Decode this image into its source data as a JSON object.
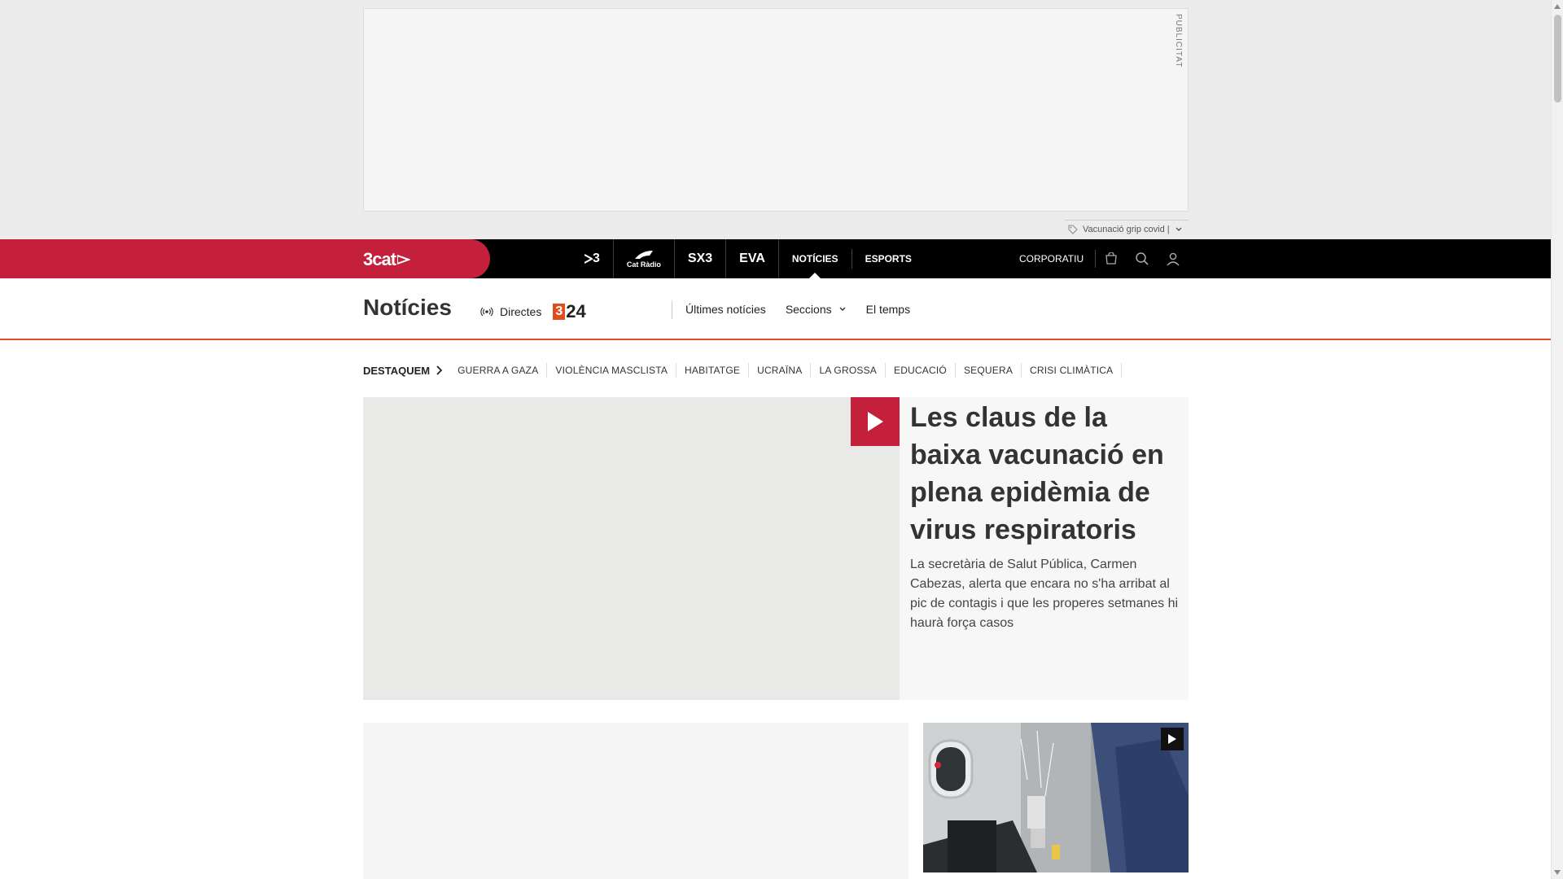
{
  "ad": {
    "label": "PUBLICITAT",
    "tag_text": "Vacunació grip covid |"
  },
  "topnav": {
    "brand": "3cat",
    "channels": [
      "3",
      "Cat Ràdio",
      "SX3",
      "EVA"
    ],
    "links": [
      {
        "label": "NOTÍCIES",
        "active": true
      },
      {
        "label": "ESPORTS",
        "active": false
      }
    ],
    "corporate": "CORPORATIU",
    "icons": [
      "cart-icon",
      "search-icon",
      "user-icon"
    ]
  },
  "section": {
    "title": "Notícies",
    "directes_label": "Directes",
    "channel_logo_digit": "3",
    "channel_logo_text": "24",
    "links": [
      "Últimes notícies",
      "Seccions",
      "El temps"
    ]
  },
  "highlights": {
    "title": "DESTAQUEM",
    "items": [
      "GUERRA A GAZA",
      "VIOLÈNCIA MASCLISTA",
      "HABITATGE",
      "UCRAÏNA",
      "LA GROSSA",
      "EDUCACIÓ",
      "SEQUERA",
      "CRISI CLIMÀTICA"
    ]
  },
  "lead": {
    "title": "Les claus de la baixa vacunació en plena epidèmia de virus respiratoris",
    "summary": "La secretària de Salut Pública, Carmen Cabezas, alerta que encara no s'ha arribat al pic de contagis i que les properes setmanes hi haurà força casos"
  },
  "colors": {
    "brand_red": "#c4203c",
    "accent_orange": "#e04e20",
    "nav_black": "#000000"
  }
}
